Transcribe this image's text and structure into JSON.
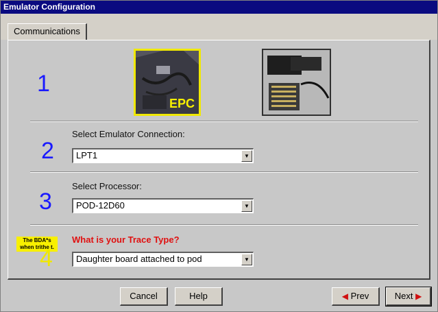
{
  "window": {
    "title": "Emulator Configuration"
  },
  "tabs": [
    {
      "label": "Communications"
    }
  ],
  "steps": {
    "step1": {
      "number": "1",
      "epc_label": "EPC"
    },
    "step2": {
      "number": "2",
      "label": "Select Emulator Connection:",
      "value": "LPT1"
    },
    "step3": {
      "number": "3",
      "label": "Select Processor:",
      "value": "POD-12D60"
    },
    "step4": {
      "number": "4",
      "label": "What is your Trace Type?",
      "value": "Daughter board attached to pod",
      "tip": "The BDA*s when trithe t."
    }
  },
  "buttons": {
    "cancel": "Cancel",
    "help": "Help",
    "prev": "Prev",
    "next": "Next"
  },
  "icons": {
    "combo_arrow": "chevron-down-icon",
    "prev_arrow": "arrow-left-icon",
    "next_arrow": "arrow-right-icon"
  },
  "colors": {
    "titlebar": "#0a0a80",
    "step_number": "#1a1aff",
    "epc_highlight": "#f0e800",
    "trace_label": "#e01010"
  }
}
